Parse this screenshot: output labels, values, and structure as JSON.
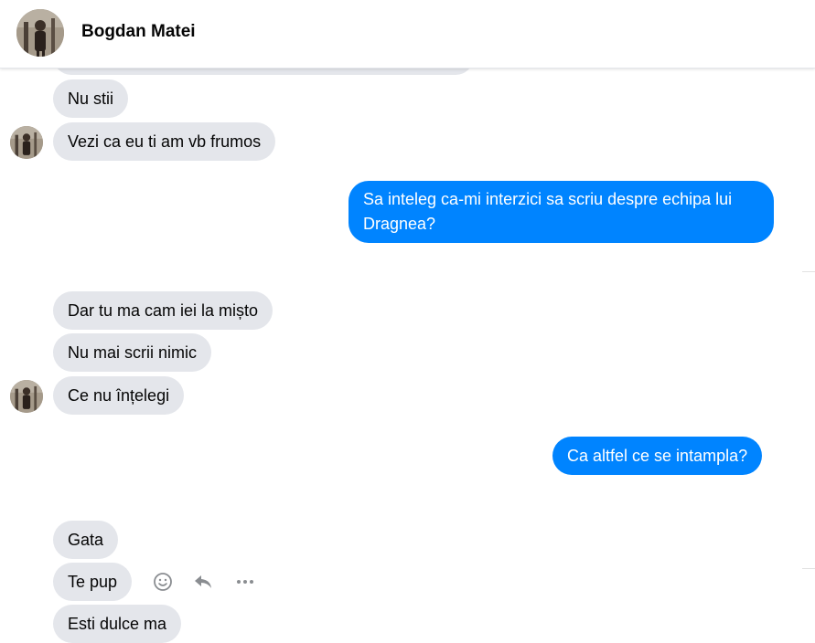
{
  "header": {
    "contact_name": "Bogdan Matei",
    "avatar_icon": "profile-photo"
  },
  "colors": {
    "incoming_bubble": "#e4e6eb",
    "outgoing_bubble": "#0084ff",
    "text_dark": "#050505",
    "text_light": "#ffffff"
  },
  "messages": [
    {
      "direction": "in",
      "text": "Nu stii"
    },
    {
      "direction": "in",
      "text": "Vezi ca eu ti am vb frumos"
    },
    {
      "direction": "out",
      "text": "Sa inteleg ca-mi interzici sa scriu despre echipa lui Dragnea?"
    },
    {
      "direction": "in",
      "text": "Dar tu ma cam iei la mișto"
    },
    {
      "direction": "in",
      "text": "Nu mai scrii nimic"
    },
    {
      "direction": "in",
      "text": "Ce nu înțelegi"
    },
    {
      "direction": "out",
      "text": "Ca altfel ce se intampla?"
    },
    {
      "direction": "in",
      "text": "Gata"
    },
    {
      "direction": "in",
      "text": "Te pup"
    },
    {
      "direction": "in",
      "text": "Esti dulce ma"
    }
  ],
  "hover_actions": [
    "smiley-icon",
    "reply-icon",
    "more-icon"
  ]
}
